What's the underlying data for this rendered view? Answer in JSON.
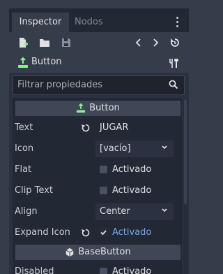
{
  "tabs": [
    {
      "label": "Inspector",
      "active": true
    },
    {
      "label": "Nodos",
      "active": false
    }
  ],
  "toolbar": {
    "icons": [
      "new-resource-icon",
      "open-folder-icon",
      "save-icon",
      "history-back-icon",
      "history-forward-icon",
      "object-history-icon"
    ]
  },
  "object": {
    "name": "Button",
    "icon": "button-node-icon",
    "tool_icon": "property-tools-icon"
  },
  "filter": {
    "placeholder": "Filtrar propiedades",
    "icon": "search-icon"
  },
  "sections": {
    "button": {
      "title": "Button"
    },
    "base_button": {
      "title": "BaseButton"
    }
  },
  "properties": {
    "text": {
      "label": "Text",
      "value": "JUGAR"
    },
    "icon": {
      "label": "Icon",
      "value": "[vacío]"
    },
    "flat": {
      "label": "Flat",
      "value": "Activado",
      "checked": false
    },
    "clip_text": {
      "label": "Clip Text",
      "value": "Activado",
      "checked": false
    },
    "align": {
      "label": "Align",
      "value": "Center"
    },
    "expand_icon": {
      "label": "Expand Icon",
      "value": "Activado",
      "checked": true
    },
    "disabled": {
      "label": "Disabled",
      "value": "Activado",
      "checked": false
    }
  },
  "colors": {
    "accent_green": "#8eef97",
    "checked_blue": "#6ea8f5",
    "panel_bg": "#2b3140"
  }
}
